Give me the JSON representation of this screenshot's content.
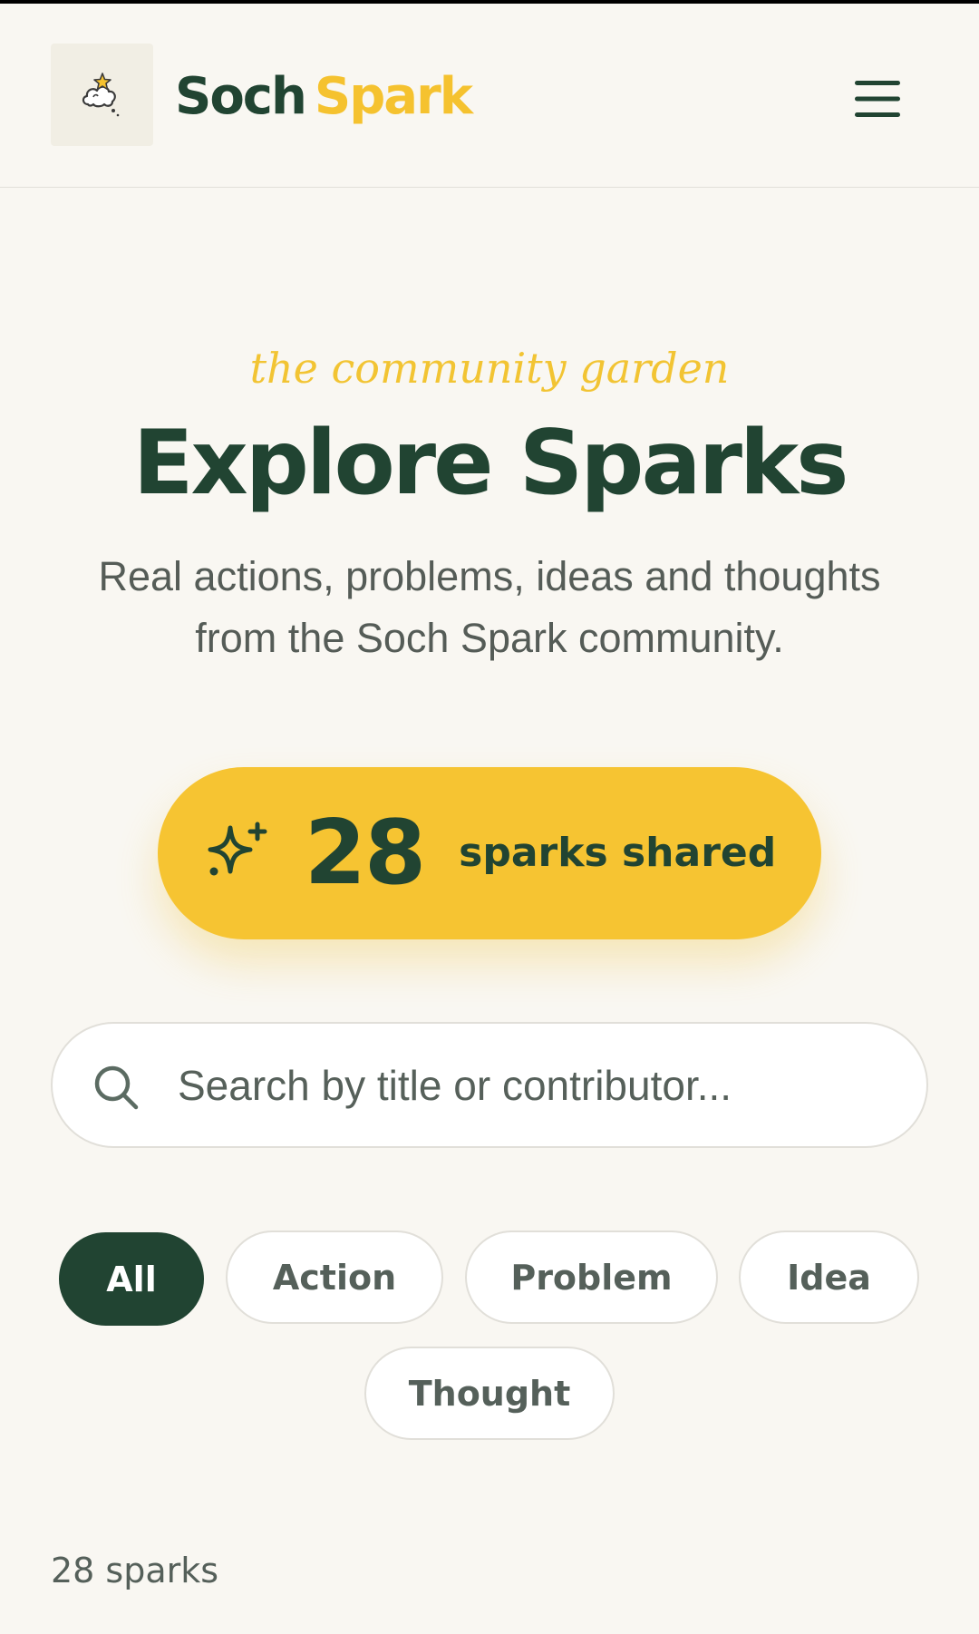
{
  "header": {
    "brand_primary": "Soch",
    "brand_accent": "Spark",
    "logo_icon": "cloud-star-icon",
    "menu_icon": "hamburger-menu-icon"
  },
  "hero": {
    "tagline": "the community garden",
    "title": "Explore Sparks",
    "subtitle": "Real actions, problems, ideas and thoughts from the Soch Spark community."
  },
  "counter": {
    "icon": "sparkle-icon",
    "value": "28",
    "label": "sparks shared"
  },
  "search": {
    "placeholder": "Search by title or contributor...",
    "value": "",
    "icon": "search-icon"
  },
  "filters": {
    "selected": "All",
    "items": [
      {
        "label": "All"
      },
      {
        "label": "Action"
      },
      {
        "label": "Problem"
      },
      {
        "label": "Idea"
      },
      {
        "label": "Thought"
      }
    ]
  },
  "results": {
    "count_text": "28 sparks"
  },
  "colors": {
    "background": "#F9F7F2",
    "brand_green": "#214432",
    "brand_yellow": "#F6C432",
    "muted_text": "#55605A"
  }
}
